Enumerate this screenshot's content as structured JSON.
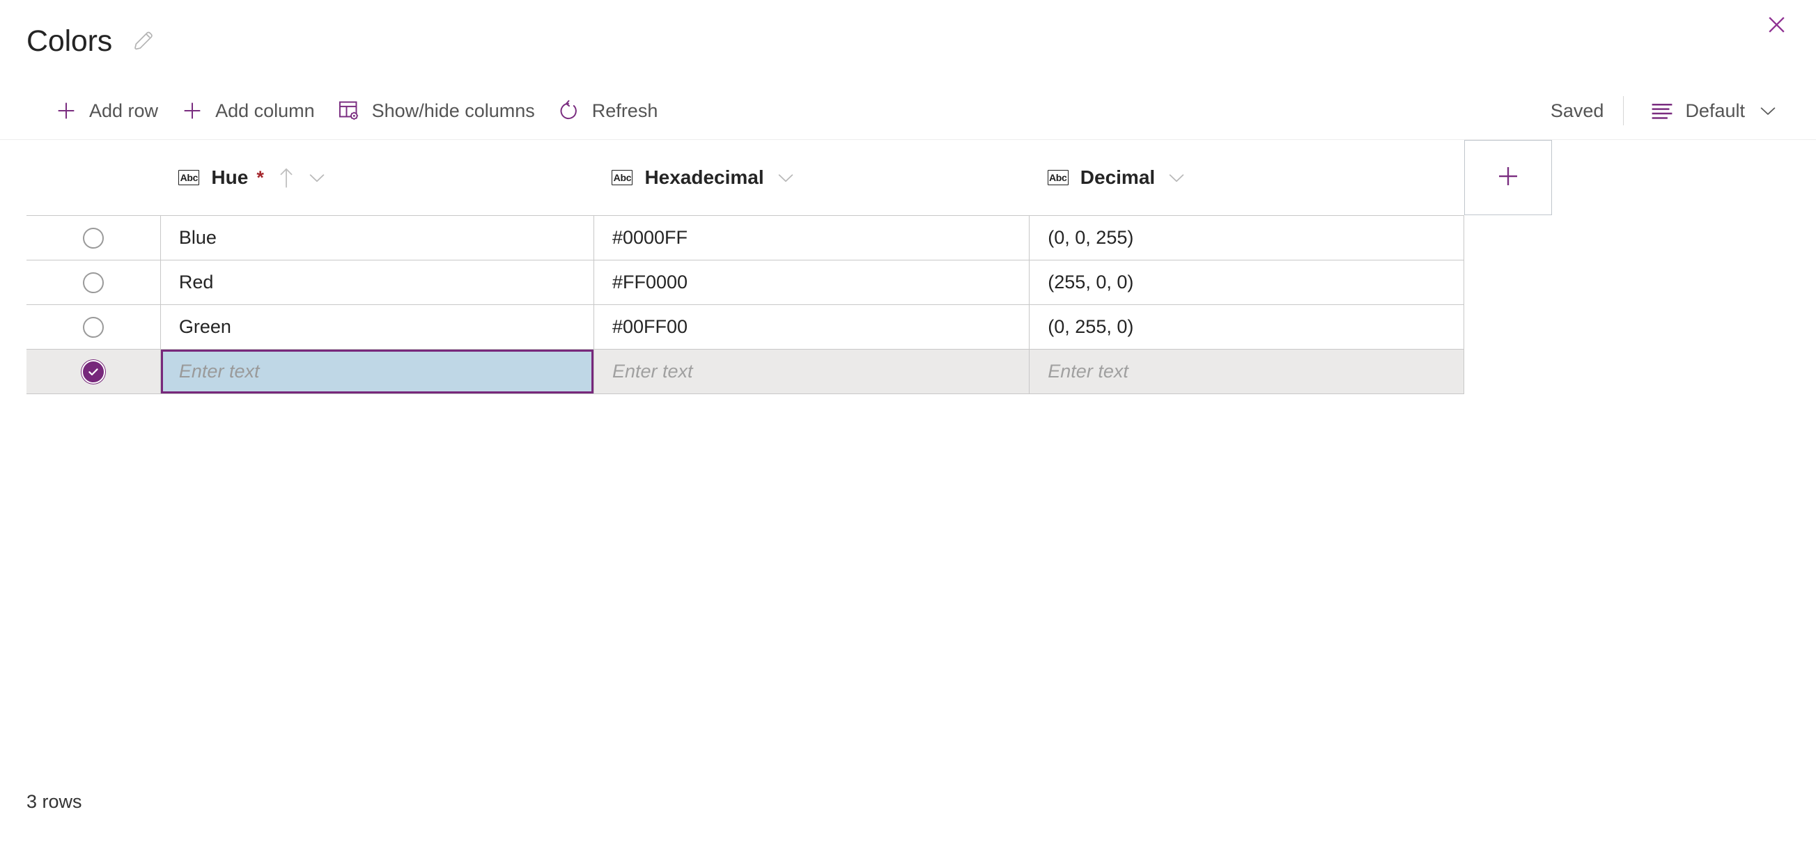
{
  "window": {
    "title": "Colors",
    "edit_icon": "pencil-icon",
    "close_icon": "close-icon"
  },
  "toolbar": {
    "buttons": [
      {
        "label": "Add row",
        "icon": "plus-icon"
      },
      {
        "label": "Add column",
        "icon": "plus-icon"
      },
      {
        "label": "Show/hide columns",
        "icon": "table-settings-icon"
      },
      {
        "label": "Refresh",
        "icon": "refresh-icon"
      }
    ],
    "status": "Saved",
    "view": {
      "label": "Default",
      "icon": "view-list-icon",
      "chevron": "chevron-down-icon"
    }
  },
  "grid": {
    "columns": [
      {
        "label": "Hue",
        "type_badge": "Abc",
        "required": true,
        "required_marker": "*",
        "sorted": true,
        "sort_icon": "arrow-up-icon",
        "chevron": "chevron-down-icon"
      },
      {
        "label": "Hexadecimal",
        "type_badge": "Abc",
        "required": false,
        "required_marker": "",
        "sorted": false,
        "sort_icon": "",
        "chevron": "chevron-down-icon"
      },
      {
        "label": "Decimal",
        "type_badge": "Abc",
        "required": false,
        "required_marker": "",
        "sorted": false,
        "sort_icon": "",
        "chevron": "chevron-down-icon"
      }
    ],
    "add_column_icon": "plus-icon",
    "rows": [
      {
        "selected": false,
        "hue": "Blue",
        "hexadecimal": "#0000FF",
        "decimal": "(0, 0, 255)"
      },
      {
        "selected": false,
        "hue": "Red",
        "hexadecimal": "#FF0000",
        "decimal": "(255, 0, 0)"
      },
      {
        "selected": false,
        "hue": "Green",
        "hexadecimal": "#00FF00",
        "decimal": "(0, 255, 0)"
      }
    ],
    "new_row": {
      "selected": true,
      "hue_placeholder": "Enter text",
      "hexadecimal_placeholder": "Enter text",
      "decimal_placeholder": "Enter text",
      "active_cell": "hue"
    }
  },
  "footer": {
    "row_count": "3 rows"
  },
  "colors": {
    "accent_purple": "#77287b",
    "active_cell_fill": "#bfd7e6",
    "selected_row_fill": "#ebeae9",
    "required_red": "#a4262c",
    "border_gray": "#c8c8c8"
  }
}
